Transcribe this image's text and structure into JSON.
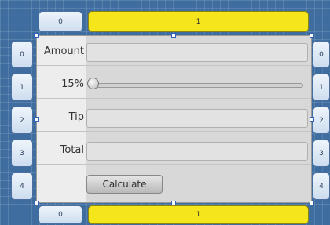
{
  "grid": {
    "columns": [
      "0",
      "1"
    ],
    "rows": [
      "0",
      "1",
      "2",
      "3",
      "4"
    ]
  },
  "form": {
    "amount": {
      "label": "Amount",
      "value": ""
    },
    "tip_percent": {
      "label": "15%",
      "value": 15,
      "min": 0,
      "max": 100
    },
    "tip": {
      "label": "Tip",
      "value": ""
    },
    "total": {
      "label": "Total",
      "value": ""
    },
    "calculate_label": "Calculate"
  },
  "colors": {
    "selected_header": "#f5e51b",
    "canvas": "#3f6da0"
  }
}
